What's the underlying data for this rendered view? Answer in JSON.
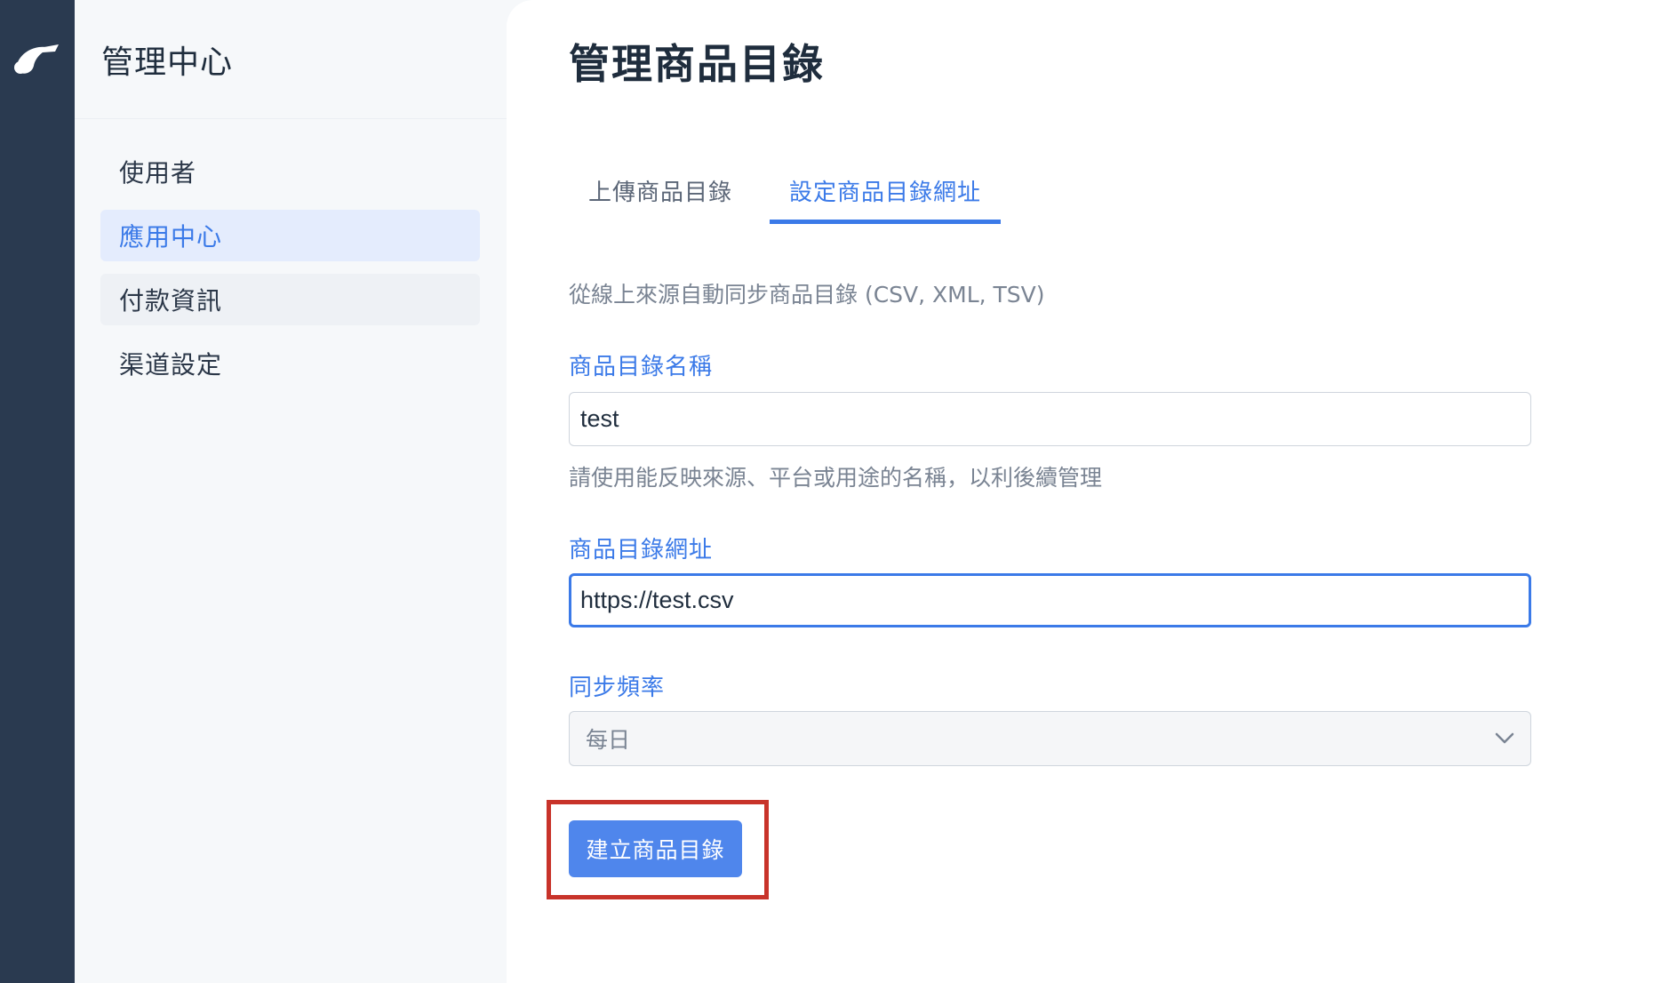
{
  "sidebar": {
    "title": "管理中心",
    "items": [
      {
        "label": "使用者"
      },
      {
        "label": "應用中心"
      },
      {
        "label": "付款資訊"
      },
      {
        "label": "渠道設定"
      }
    ]
  },
  "main": {
    "page_title": "管理商品目錄",
    "tabs": [
      {
        "label": "上傳商品目錄"
      },
      {
        "label": "設定商品目錄網址"
      }
    ],
    "description": "從線上來源自動同步商品目錄 (CSV, XML, TSV)",
    "form": {
      "name_label": "商品目錄名稱",
      "name_value": "test",
      "name_hint": "請使用能反映來源、平台或用途的名稱，以利後續管理",
      "url_label": "商品目錄網址",
      "url_value": "https://test.csv",
      "frequency_label": "同步頻率",
      "frequency_value": "每日",
      "submit_label": "建立商品目錄"
    }
  },
  "colors": {
    "accent": "#3b7ae8",
    "rail": "#2a3a50",
    "highlight": "#c8332a"
  }
}
